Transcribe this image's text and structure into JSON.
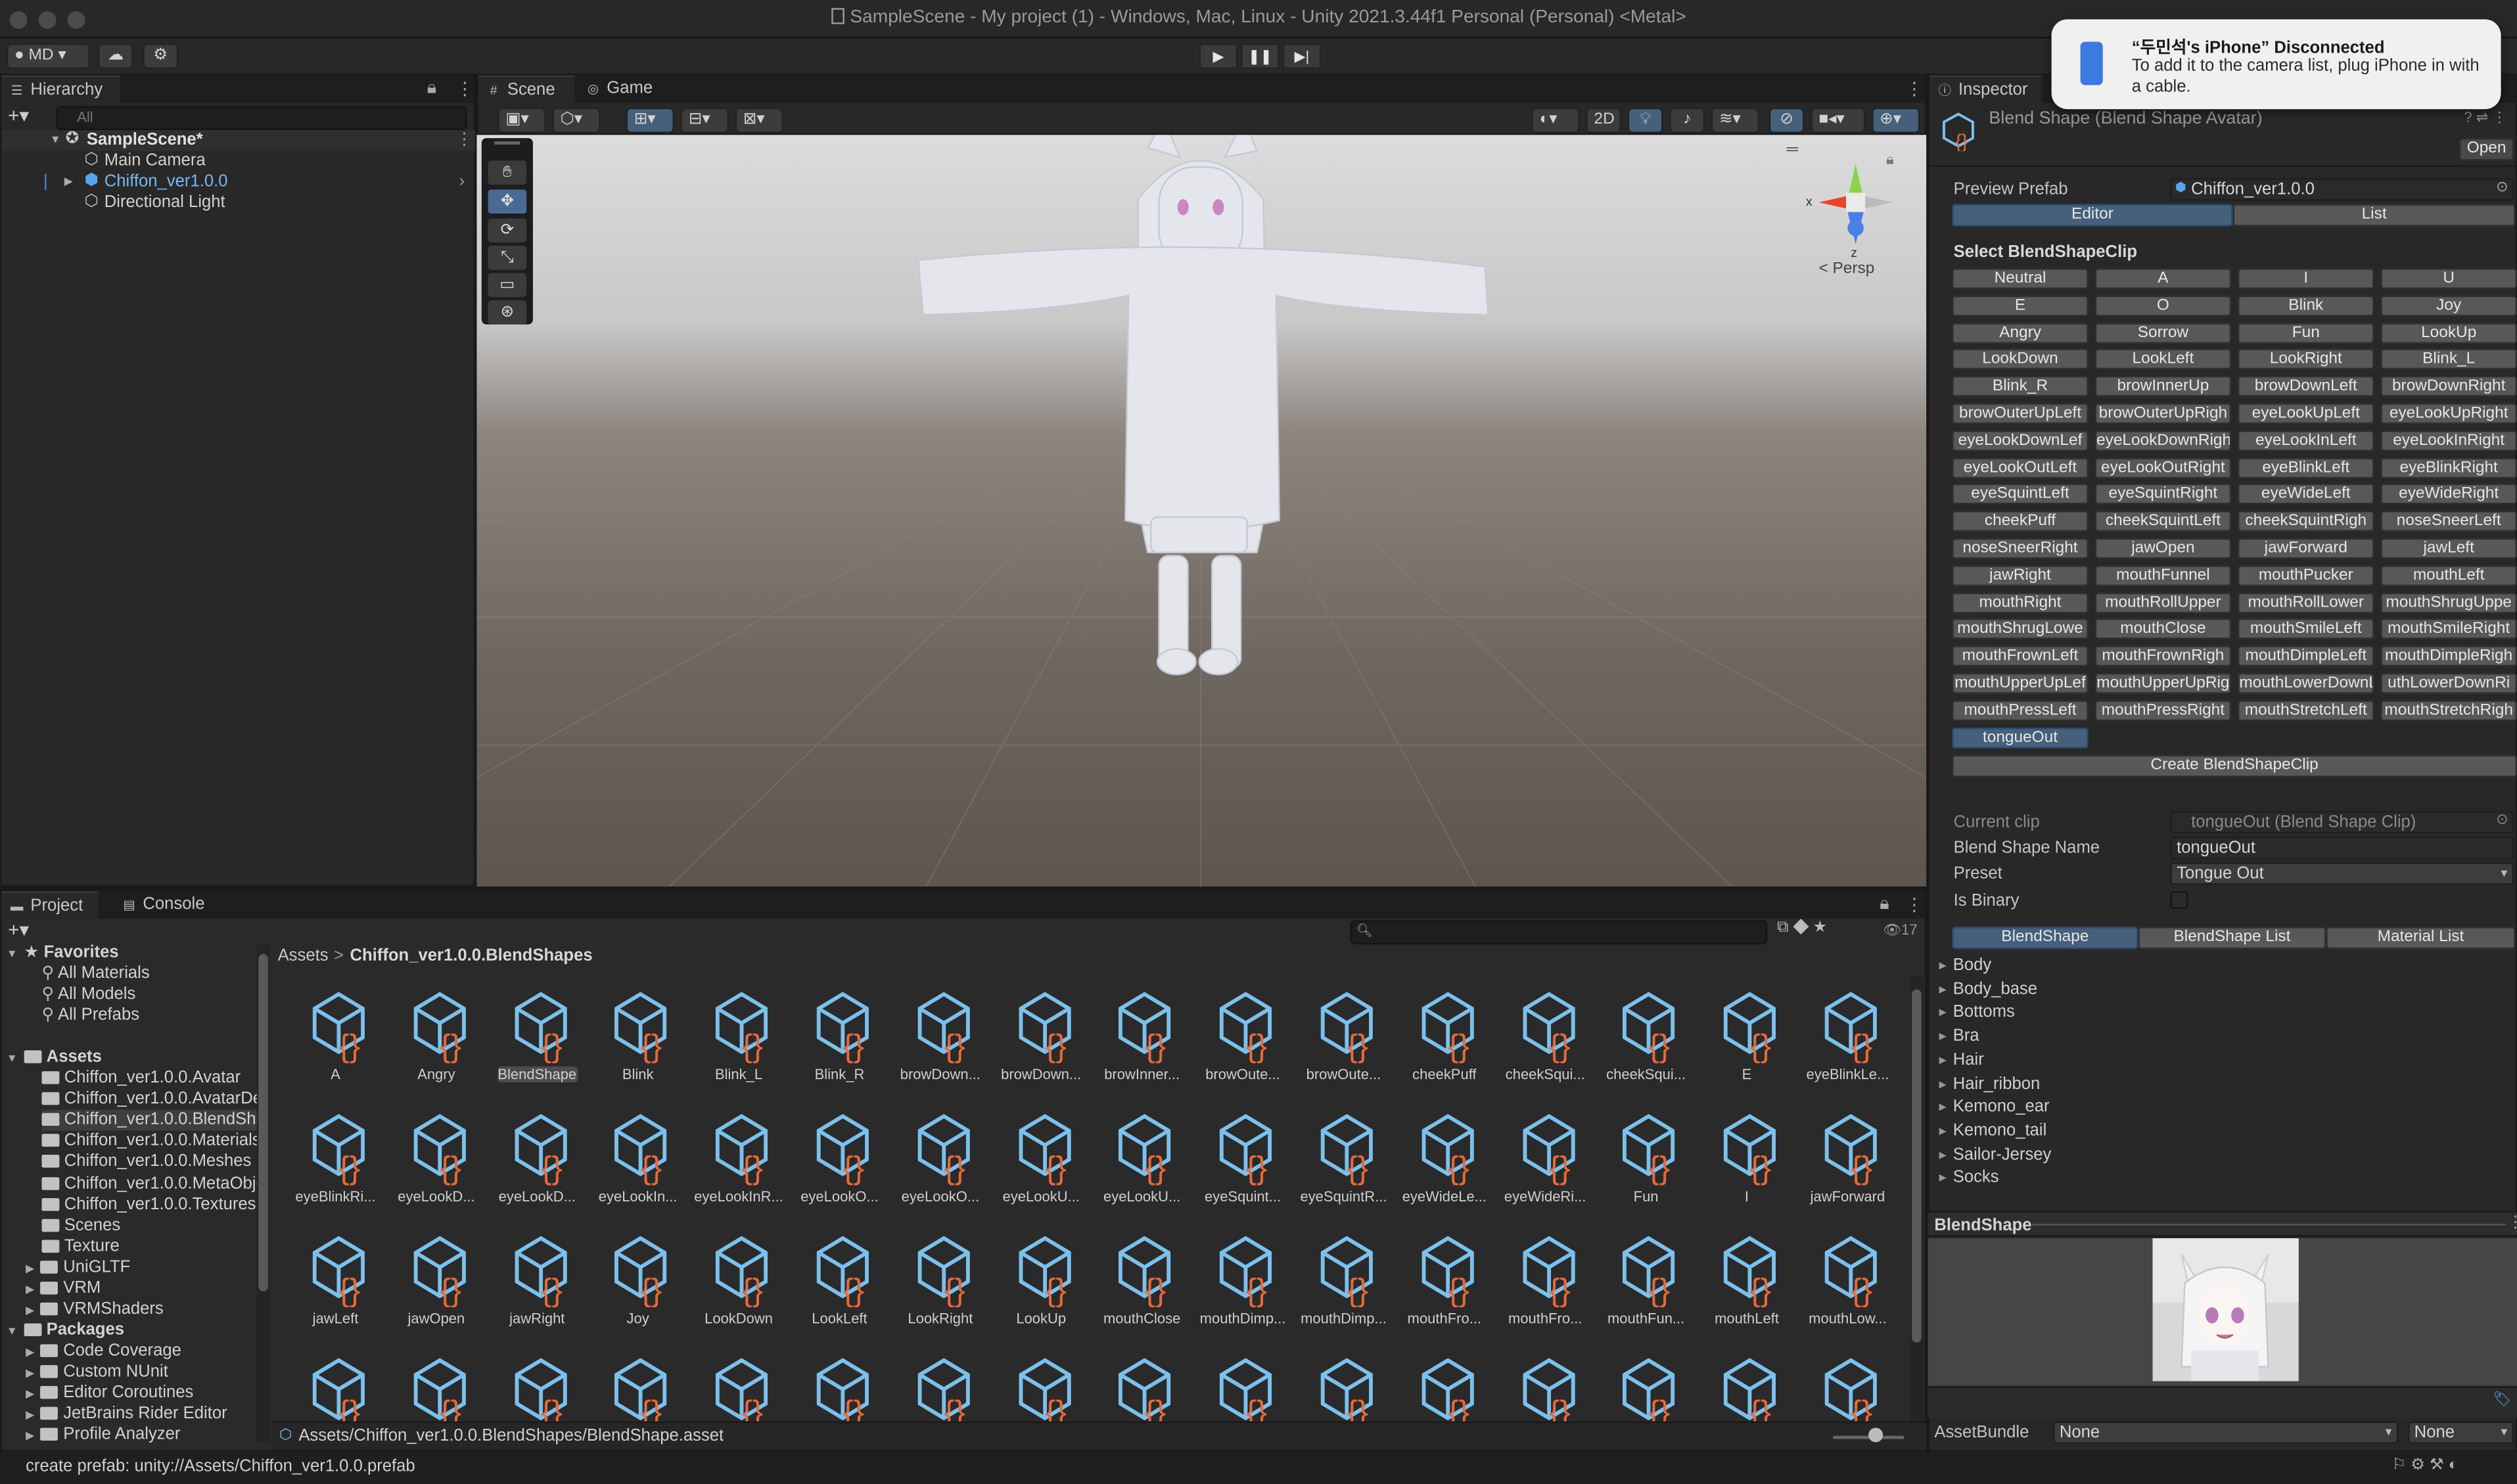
{
  "window": {
    "title": "SampleScene - My project (1) - Windows, Mac, Linux - Unity 2021.3.44f1 Personal (Personal) <Metal>"
  },
  "toolbar": {
    "account": "MD",
    "play_icon": "▶",
    "pause_icon": "❚❚",
    "step_icon": "▶|"
  },
  "notification": {
    "title": "“두민석's iPhone” Disconnected",
    "body": "To add it to the camera list, plug iPhone in with a cable."
  },
  "hierarchy": {
    "tab": "Hierarchy",
    "search_placeholder": "All",
    "scene": "SampleScene*",
    "items": [
      "Main Camera",
      "Chiffon_ver1.0.0",
      "Directional Light"
    ]
  },
  "scene_tabs": {
    "scene": "Scene",
    "game": "Game",
    "mode_2d": "2D",
    "persp": "< Persp",
    "gizmo_x": "x",
    "gizmo_z": "z"
  },
  "inspector": {
    "tab": "Inspector",
    "header": "Blend Shape (Blend Shape Avatar)",
    "open_button": "Open",
    "preview_prefab_label": "Preview Prefab",
    "preview_prefab_value": "Chiffon_ver1.0.0",
    "editor_tab": "Editor",
    "list_tab": "List",
    "select_clip_title": "Select BlendShapeClip",
    "clips": [
      "Neutral",
      "A",
      "I",
      "U",
      "E",
      "O",
      "Blink",
      "Joy",
      "Angry",
      "Sorrow",
      "Fun",
      "LookUp",
      "LookDown",
      "LookLeft",
      "LookRight",
      "Blink_L",
      "Blink_R",
      "browInnerUp",
      "browDownLeft",
      "browDownRight",
      "browOuterUpLeft",
      "browOuterUpRigh",
      "eyeLookUpLeft",
      "eyeLookUpRight",
      "eyeLookDownLef",
      "eyeLookDownRigh",
      "eyeLookInLeft",
      "eyeLookInRight",
      "eyeLookOutLeft",
      "eyeLookOutRight",
      "eyeBlinkLeft",
      "eyeBlinkRight",
      "eyeSquintLeft",
      "eyeSquintRight",
      "eyeWideLeft",
      "eyeWideRight",
      "cheekPuff",
      "cheekSquintLeft",
      "cheekSquintRigh",
      "noseSneerLeft",
      "noseSneerRight",
      "jawOpen",
      "jawForward",
      "jawLeft",
      "jawRight",
      "mouthFunnel",
      "mouthPucker",
      "mouthLeft",
      "mouthRight",
      "mouthRollUpper",
      "mouthRollLower",
      "mouthShrugUppe",
      "mouthShrugLowe",
      "mouthClose",
      "mouthSmileLeft",
      "mouthSmileRight",
      "mouthFrownLeft",
      "mouthFrownRigh",
      "mouthDimpleLeft",
      "mouthDimpleRigh",
      "mouthUpperUpLef",
      "mouthUpperUpRig",
      "mouthLowerDownL",
      "uthLowerDownRi",
      "mouthPressLeft",
      "mouthPressRight",
      "mouthStretchLeft",
      "mouthStretchRigh",
      "tongueOut"
    ],
    "selected_clip": "tongueOut",
    "create_button": "Create BlendShapeClip",
    "current_clip_label": "Current clip",
    "current_clip_value": "tongueOut (Blend Shape Clip)",
    "blendshape_name_label": "Blend Shape Name",
    "blendshape_name_value": "tongueOut",
    "preset_label": "Preset",
    "preset_value": "Tongue Out",
    "is_binary_label": "Is Binary",
    "sub_tabs": [
      "BlendShape",
      "BlendShape List",
      "Material List"
    ],
    "meshes": [
      "Body",
      "Body_base",
      "Bottoms",
      "Bra",
      "Hair",
      "Hair_ribbon",
      "Kemono_ear",
      "Kemono_tail",
      "Sailor-Jersey",
      "Socks"
    ],
    "preview_title": "BlendShape",
    "assetbundle_label": "AssetBundle",
    "assetbundle_value": "None",
    "assetbundle_variant": "None"
  },
  "project": {
    "tab_project": "Project",
    "tab_console": "Console",
    "count": "17",
    "favorites_title": "Favorites",
    "favorites": [
      "All Materials",
      "All Models",
      "All Prefabs"
    ],
    "assets_title": "Assets",
    "asset_folders": [
      "Chiffon_ver1.0.0.Avatar",
      "Chiffon_ver1.0.0.AvatarDe",
      "Chiffon_ver1.0.0.BlendSha",
      "Chiffon_ver1.0.0.Materials",
      "Chiffon_ver1.0.0.Meshes",
      "Chiffon_ver1.0.0.MetaObje",
      "Chiffon_ver1.0.0.Textures",
      "Scenes",
      "Texture",
      "UniGLTF",
      "VRM",
      "VRMShaders"
    ],
    "packages_title": "Packages",
    "packages": [
      "Code Coverage",
      "Custom NUnit",
      "Editor Coroutines",
      "JetBrains Rider Editor",
      "Profile Analyzer"
    ],
    "breadcrumb_root": "Assets",
    "breadcrumb_sep": ">",
    "breadcrumb_current": "Chiffon_ver1.0.0.BlendShapes",
    "assets": [
      "A",
      "Angry",
      "BlendShape",
      "Blink",
      "Blink_L",
      "Blink_R",
      "browDown...",
      "browDown...",
      "browInner...",
      "browOute...",
      "browOute...",
      "cheekPuff",
      "cheekSqui...",
      "cheekSqui...",
      "E",
      "eyeBlinkLe...",
      "eyeBlinkRi...",
      "eyeLookD...",
      "eyeLookD...",
      "eyeLookIn...",
      "eyeLookInR...",
      "eyeLookO...",
      "eyeLookO...",
      "eyeLookU...",
      "eyeLookU...",
      "eyeSquint...",
      "eyeSquintR...",
      "eyeWideLe...",
      "eyeWideRi...",
      "Fun",
      "I",
      "jawForward",
      "jawLeft",
      "jawOpen",
      "jawRight",
      "Joy",
      "LookDown",
      "LookLeft",
      "LookRight",
      "LookUp",
      "mouthClose",
      "mouthDimp...",
      "mouthDimp...",
      "mouthFro...",
      "mouthFro...",
      "mouthFun...",
      "mouthLeft",
      "mouthLow...",
      "",
      "",
      "",
      "",
      "",
      "",
      "",
      "",
      "",
      "",
      "",
      "",
      "",
      "",
      "",
      ""
    ],
    "selected_asset": "BlendShape",
    "footer_path": "Assets/Chiffon_ver1.0.0.BlendShapes/BlendShape.asset"
  },
  "status": {
    "message": "create prefab: unity://Assets/Chiffon_ver1.0.0.prefab"
  },
  "colors": {
    "accent": "#46607c",
    "asset_cube": "#7cc0ec",
    "asset_braces": "#e8693a"
  }
}
